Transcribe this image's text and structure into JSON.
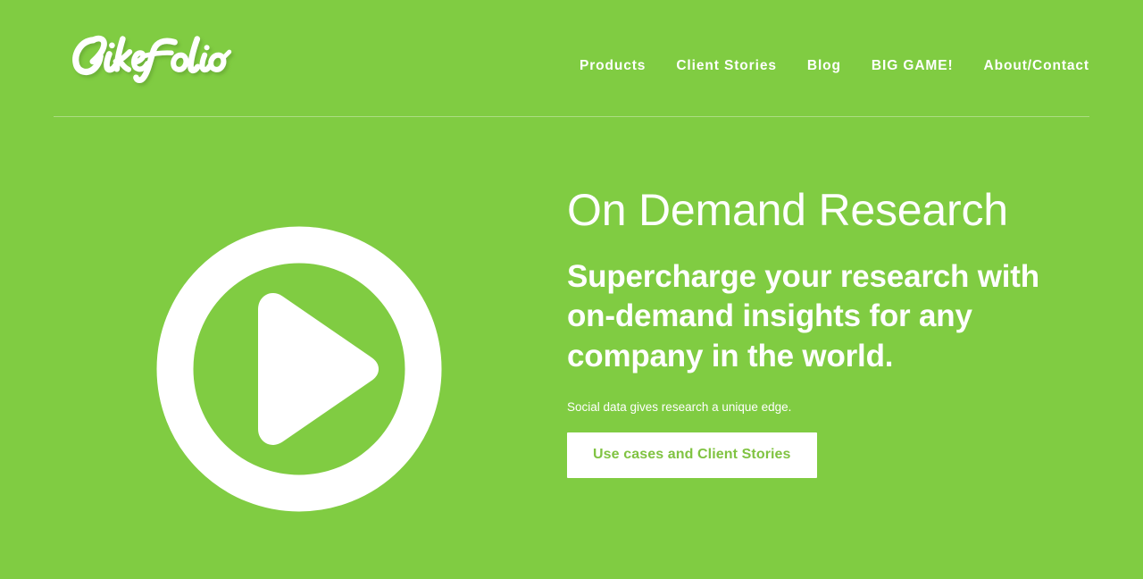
{
  "theme": {
    "background_green": "#80cc42",
    "text_white": "#ffffff",
    "cta_text_green": "#80c342",
    "cta_background": "#ffffff",
    "divider": "rgba(255,255,255,0.34)"
  },
  "header": {
    "logo": {
      "text": "LikeFolio",
      "icon": "likefolio-script-logo"
    },
    "nav": {
      "items": [
        {
          "label": "Products"
        },
        {
          "label": "Client Stories"
        },
        {
          "label": "Blog"
        },
        {
          "label": "BIG GAME!"
        },
        {
          "label": "About/Contact"
        }
      ]
    }
  },
  "hero": {
    "video": {
      "icon": "play-circle-icon",
      "label": "Play video"
    },
    "eyebrow": "On Demand Research",
    "headline": "Supercharge your research with on-demand insights for any company in the world.",
    "subcopy": "Social data gives research a unique edge.",
    "cta_label": "Use cases and Client Stories"
  }
}
